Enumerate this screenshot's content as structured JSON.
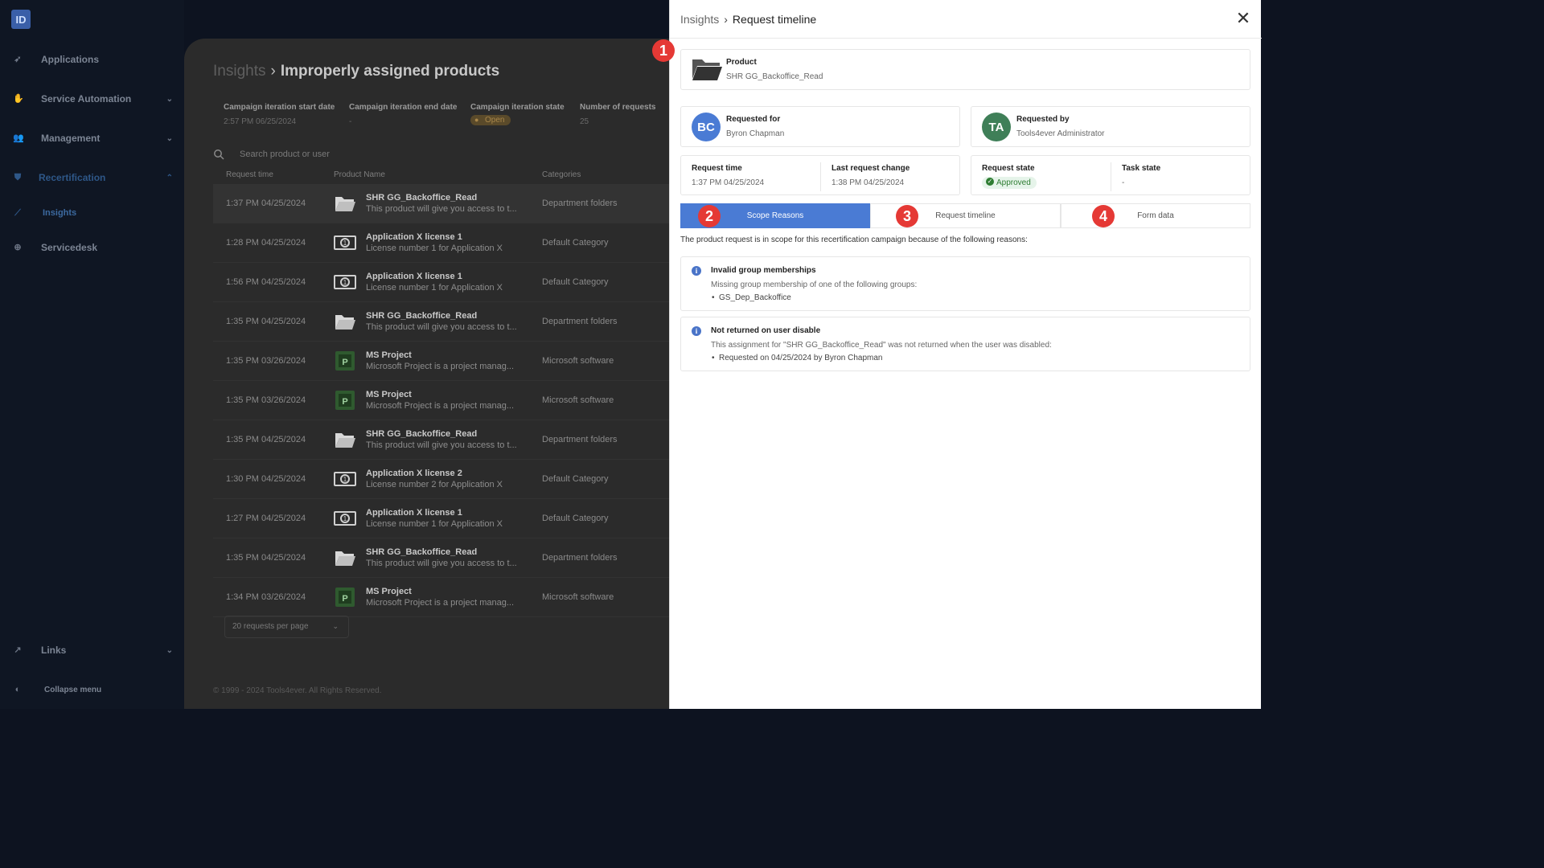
{
  "sidebar": {
    "logo": "ID",
    "items": [
      {
        "label": "Applications"
      },
      {
        "label": "Service Automation"
      },
      {
        "label": "Management"
      },
      {
        "label": "Recertification"
      },
      {
        "label": "Insights"
      },
      {
        "label": "Servicedesk"
      }
    ],
    "links": "Links",
    "collapse": "Collapse menu"
  },
  "main": {
    "breadcrumb": {
      "parent": "Insights",
      "current": "Improperly assigned products"
    },
    "stats": [
      {
        "label": "Campaign iteration start date",
        "value": "2:57 PM 06/25/2024"
      },
      {
        "label": "Campaign iteration end date",
        "value": "-"
      },
      {
        "label": "Campaign iteration state",
        "value": "Open"
      },
      {
        "label": "Number of requests",
        "value": "25"
      }
    ],
    "search_placeholder": "Search product or user",
    "columns": [
      "Request time",
      "Product Name",
      "Categories"
    ],
    "rows": [
      {
        "time": "1:37 PM 04/25/2024",
        "name": "SHR GG_Backoffice_Read",
        "desc": "This product will give you access to t...",
        "category": "Department folders",
        "icon": "folder-icon"
      },
      {
        "time": "1:28 PM 04/25/2024",
        "name": "Application X license 1",
        "desc": "License number 1 for Application X",
        "category": "Default Category",
        "icon": "license-icon"
      },
      {
        "time": "1:56 PM 04/25/2024",
        "name": "Application X license 1",
        "desc": "License number 1 for Application X",
        "category": "Default Category",
        "icon": "license-icon"
      },
      {
        "time": "1:35 PM 04/25/2024",
        "name": "SHR GG_Backoffice_Read",
        "desc": "This product will give you access to t...",
        "category": "Department folders",
        "icon": "folder-icon"
      },
      {
        "time": "1:35 PM 03/26/2024",
        "name": "MS Project",
        "desc": "Microsoft Project is a project manag...",
        "category": "Microsoft software",
        "icon": "ms-project-icon"
      },
      {
        "time": "1:35 PM 03/26/2024",
        "name": "MS Project",
        "desc": "Microsoft Project is a project manag...",
        "category": "Microsoft software",
        "icon": "ms-project-icon"
      },
      {
        "time": "1:35 PM 04/25/2024",
        "name": "SHR GG_Backoffice_Read",
        "desc": "This product will give you access to t...",
        "category": "Department folders",
        "icon": "folder-icon"
      },
      {
        "time": "1:30 PM 04/25/2024",
        "name": "Application X license 2",
        "desc": "License number 2 for Application X",
        "category": "Default Category",
        "icon": "license-icon"
      },
      {
        "time": "1:27 PM 04/25/2024",
        "name": "Application X license 1",
        "desc": "License number 1 for Application X",
        "category": "Default Category",
        "icon": "license-icon"
      },
      {
        "time": "1:35 PM 04/25/2024",
        "name": "SHR GG_Backoffice_Read",
        "desc": "This product will give you access to t...",
        "category": "Department folders",
        "icon": "folder-icon"
      },
      {
        "time": "1:34 PM 03/26/2024",
        "name": "MS Project",
        "desc": "Microsoft Project is a project manag...",
        "category": "Microsoft software",
        "icon": "ms-project-icon"
      }
    ],
    "pager": "20 requests per page",
    "footer": "© 1999 - 2024 Tools4ever. All Rights Reserved."
  },
  "drawer": {
    "breadcrumb": {
      "parent": "Insights",
      "current": "Request timeline"
    },
    "product": {
      "title": "Product",
      "value": "SHR GG_Backoffice_Read"
    },
    "requested_for": {
      "title": "Requested for",
      "value": "Byron Chapman",
      "initials": "BC",
      "color": "#4a7bd4"
    },
    "requested_by": {
      "title": "Requested by",
      "value": "Tools4ever Administrator",
      "initials": "TA",
      "color": "#3f7f58"
    },
    "request_time": {
      "title": "Request time",
      "value": "1:37 PM 04/25/2024"
    },
    "last_change": {
      "title": "Last request change",
      "value": "1:38 PM 04/25/2024"
    },
    "request_state": {
      "title": "Request state",
      "value": "Approved"
    },
    "task_state": {
      "title": "Task state",
      "value": "-"
    },
    "tabs": [
      {
        "label": "Scope Reasons",
        "active": true
      },
      {
        "label": "Request timeline",
        "active": false
      },
      {
        "label": "Form data",
        "active": false
      }
    ],
    "intro": "The product request is in scope for this recertification campaign because of the following reasons:",
    "reasons": [
      {
        "title": "Invalid group memberships",
        "desc": "Missing group membership of one of the following groups:",
        "bullet": "GS_Dep_Backoffice"
      },
      {
        "title": "Not returned on user disable",
        "desc": "This assignment for \"SHR GG_Backoffice_Read\" was not returned when the user was disabled:",
        "bullet": "Requested on 04/25/2024 by Byron Chapman"
      }
    ]
  },
  "markers": [
    "1",
    "2",
    "3",
    "4"
  ],
  "colors": {
    "accent": "#4a7bd4",
    "marker": "#e53935",
    "approved": "#2e7d32"
  }
}
